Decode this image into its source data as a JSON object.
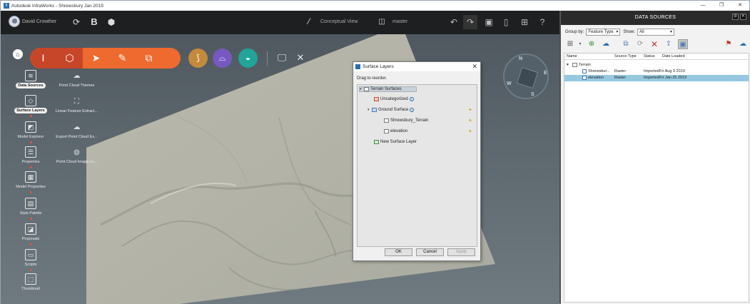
{
  "window": {
    "title": "Autodesk InfraWorks - Shrewsbury Jan 2019",
    "controls": [
      "—",
      "❐",
      "✕"
    ]
  },
  "topbar": {
    "user_name": "David Crowther",
    "view_mode": "Conceptual View",
    "branch": "master"
  },
  "palette_left": [
    {
      "label": "Data Sources",
      "highlight": true
    },
    {
      "label": "Surface Layers",
      "highlight": true
    },
    {
      "label": "Model Explorer",
      "highlight": false
    },
    {
      "label": "Properties",
      "highlight": false
    },
    {
      "label": "Model Properties",
      "highlight": false
    },
    {
      "label": "Style Palette",
      "highlight": false
    },
    {
      "label": "Proposals",
      "highlight": false
    },
    {
      "label": "Scripts",
      "highlight": false
    },
    {
      "label": "Thumbnail",
      "highlight": false
    }
  ],
  "palette_right": [
    {
      "label": "Point Cloud Themes"
    },
    {
      "label": "Linear Feature Extract..."
    },
    {
      "label": "Export Point Cloud Ex..."
    },
    {
      "label": "Point Cloud Image Lo..."
    }
  ],
  "compass": {
    "n": "N",
    "w": "W",
    "e": "E",
    "s": "S"
  },
  "dialog": {
    "title": "Surface Layers",
    "hint": "Drag to reorder.",
    "tree": {
      "root": "Terrain Surfaces",
      "uncategorized": "Uncategorized",
      "ground": "Ground Surface",
      "child1": "Shrewsbury_Terrain",
      "child2": "elevation",
      "new_layer": "New Surface Layer"
    },
    "ok": "OK",
    "cancel": "Cancel",
    "apply": "Apply"
  },
  "data_sources": {
    "title": "DATA SOURCES",
    "group_by_label": "Group by:",
    "group_by_value": "Feature Type",
    "show_label": "Show:",
    "show_value": "All",
    "columns": [
      "Name",
      "Source Type",
      "Status",
      "Date Loaded"
    ],
    "group": "Terrain",
    "rows": [
      {
        "name": "Shrewsbur...",
        "type": "Raster",
        "status": "Imported",
        "date": "Fri Aug 9 2019",
        "selected": false
      },
      {
        "name": "elevation",
        "type": "Raster",
        "status": "Imported",
        "date": "Fri Jan 25 2019",
        "selected": true
      }
    ]
  }
}
